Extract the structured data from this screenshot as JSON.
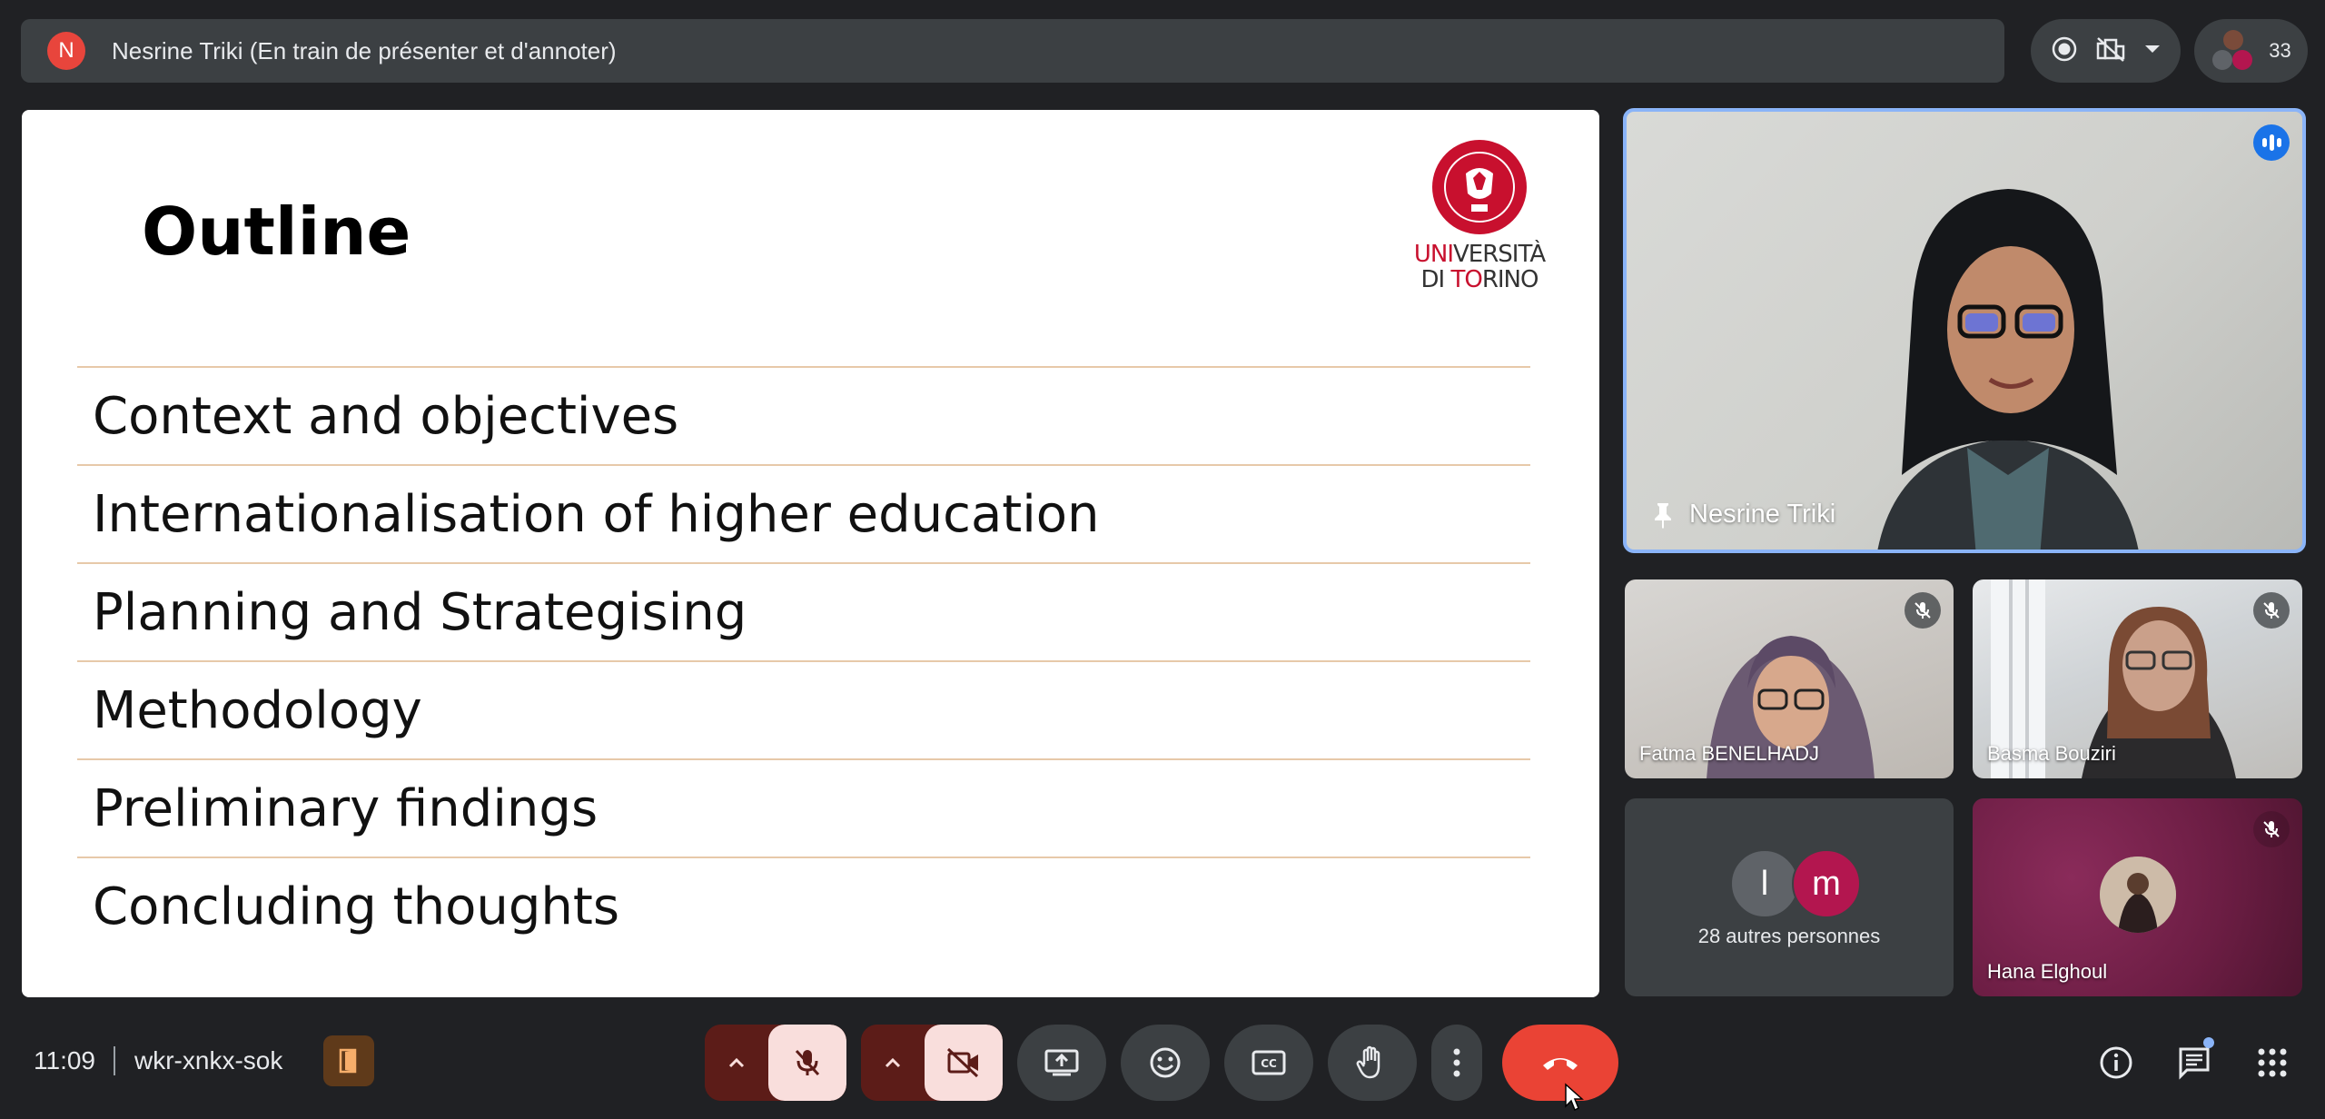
{
  "banner": {
    "avatar_letter": "N",
    "presenter_text": "Nesrine Triki (En train de présenter et d'annoter)",
    "people_count": "33"
  },
  "slide": {
    "title": "Outline",
    "logo_line1_red": "UNI",
    "logo_line1_rest": "VERSITÀ",
    "logo_line2_prefix": "DI ",
    "logo_line2_red": "TO",
    "logo_line2_rest": "RINO",
    "items": [
      "Context and objectives",
      "Internationalisation of higher education",
      "Planning and Strategising",
      "Methodology",
      "Preliminary findings",
      "Concluding thoughts"
    ]
  },
  "participants": {
    "main": {
      "name": "Nesrine Triki"
    },
    "tiles": [
      {
        "name": "Fatma BENELHADJ"
      },
      {
        "name": "Basma Bouziri"
      },
      {
        "name": "Hana Elghoul"
      }
    ],
    "others": {
      "label": "28 autres personnes",
      "avatar1": "l",
      "avatar2": "m"
    }
  },
  "bottom": {
    "time": "11:09",
    "meeting_code": "wkr-xnkx-sok"
  },
  "colors": {
    "accent": "#8ab4f8",
    "hangup": "#ea4335",
    "muted_bg": "#f9dedc",
    "banner_bg": "#3c4043"
  }
}
